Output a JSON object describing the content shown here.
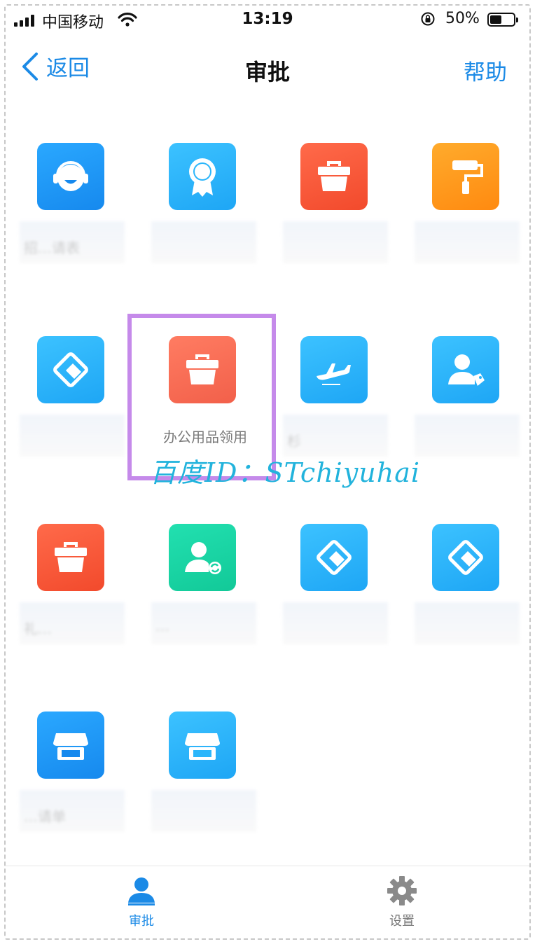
{
  "status_bar": {
    "carrier": "中国移动",
    "time": "13:19",
    "battery_percent_text": "50%",
    "battery_level": 0.5
  },
  "nav": {
    "back_label": "返回",
    "title": "审批",
    "help_label": "帮助"
  },
  "grid": {
    "highlighted_label": "办公用品领用",
    "partial_label_hint": "杉",
    "ghost_labels": {
      "r1c1": "招…请表",
      "r3c1": "礼…",
      "r3c2": "…",
      "r4c1": "…请单"
    }
  },
  "watermark": "百度ID：STchiyuhai",
  "tabbar": {
    "approval_label": "审批",
    "settings_label": "设置"
  },
  "colors": {
    "accent": "#1b8ae6",
    "highlight_border": "#c58aea",
    "watermark": "#22b3dc"
  }
}
